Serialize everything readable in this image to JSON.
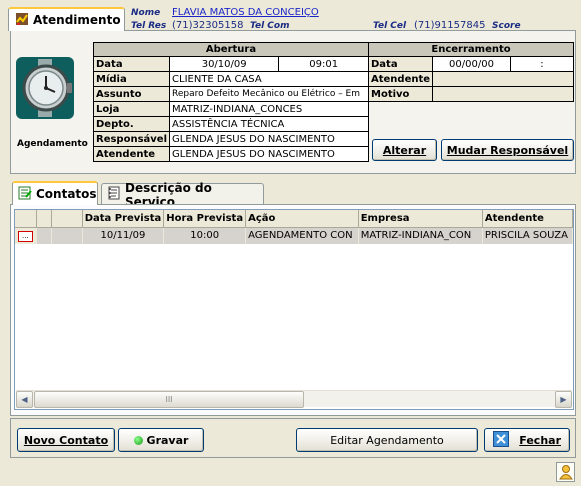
{
  "tab_atendimento": "Atendimento",
  "header": {
    "nome_label": "Nome",
    "nome_value": "FLAVIA MATOS DA CONCEIÇO",
    "telres_label": "Tel Res",
    "telres_value": "(71)32305158",
    "telcom_label": "Tel Com",
    "telcel_label": "Tel Cel",
    "telcel_value": "(71)91157845",
    "score_label": "Score"
  },
  "agendamento_label": "Agendamento",
  "abertura": {
    "title": "Abertura",
    "rows": [
      {
        "label": "Data",
        "value": "30/10/09",
        "extra": "09:01"
      },
      {
        "label": "Mídia",
        "value": "CLIENTE DA CASA"
      },
      {
        "label": "Assunto",
        "value": "Reparo Defeito Mecânico ou Elétrico – Em"
      },
      {
        "label": "Loja",
        "value": "MATRIZ-INDIANA_CONCES"
      },
      {
        "label": "Depto.",
        "value": "ASSISTÊNCIA TÉCNICA"
      },
      {
        "label": "Responsável",
        "value": "GLENDA JESUS DO NASCIMENTO"
      },
      {
        "label": "Atendente",
        "value": "GLENDA JESUS DO NASCIMENTO"
      }
    ]
  },
  "encerramento": {
    "title": "Encerramento",
    "data_label": "Data",
    "data_value": "00/00/00",
    "time_value": ":",
    "atendente_label": "Atendente",
    "motivo_label": "Motivo"
  },
  "buttons": {
    "alterar": "Alterar",
    "mudar_responsavel": "Mudar Responsável",
    "novo_contato": "Novo Contato",
    "gravar": "Gravar",
    "editar_agendamento": "Editar Agendamento",
    "fechar": "Fechar"
  },
  "tabs": {
    "contatos": "Contatos",
    "descricao": "Descrição do Serviço"
  },
  "contacts_table": {
    "columns": [
      "Data Prevista",
      "Hora Prevista",
      "Ação",
      "Empresa",
      "Atendente"
    ],
    "rows": [
      {
        "btn": "...",
        "data": "10/11/09",
        "hora": "10:00",
        "acao": "AGENDAMENTO CON",
        "empresa": "MATRIZ-INDIANA_CON",
        "atendente": "PRISCILA SOUZA"
      }
    ]
  },
  "scrollbar_thumb": "III",
  "colors": {
    "window_bg": "#ece9d8",
    "tab_highlight": "#ffc83c",
    "header_blue": "#1b2c84",
    "selected_marker": "#d00000"
  }
}
